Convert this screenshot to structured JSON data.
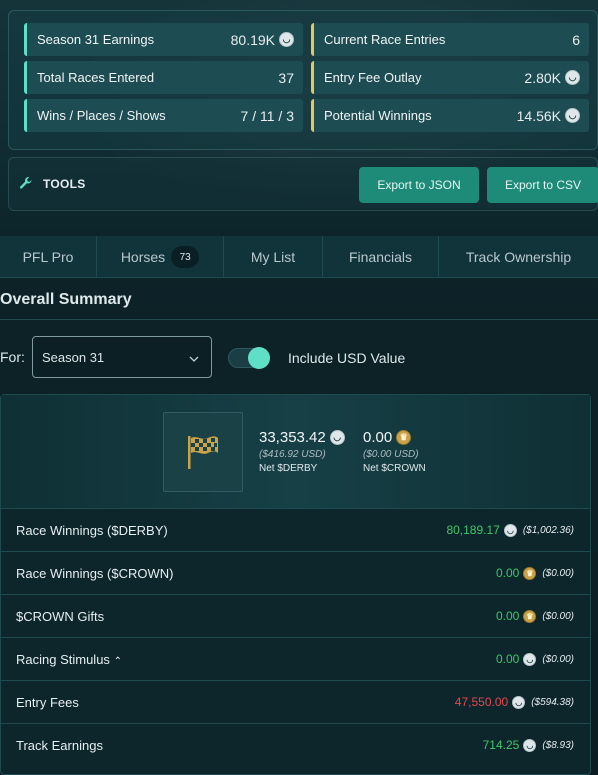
{
  "stats": {
    "left": [
      {
        "label": "Season 31 Earnings",
        "value": "80.19K",
        "coin": "derby"
      },
      {
        "label": "Total Races Entered",
        "value": "37",
        "coin": ""
      },
      {
        "label": "Wins / Places / Shows",
        "value": "7 / 11 / 3",
        "coin": ""
      }
    ],
    "right": [
      {
        "label": "Current Race Entries",
        "value": "6",
        "coin": ""
      },
      {
        "label": "Entry Fee Outlay",
        "value": "2.80K",
        "coin": "derby"
      },
      {
        "label": "Potential Winnings",
        "value": "14.56K",
        "coin": "derby"
      }
    ]
  },
  "tools": {
    "label": "TOOLS",
    "export_json": "Export to JSON",
    "export_csv": "Export to CSV"
  },
  "tabs": [
    {
      "label": "PFL Pro"
    },
    {
      "label": "Horses",
      "count": "73"
    },
    {
      "label": "My List"
    },
    {
      "label": "Financials"
    },
    {
      "label": "Track Ownership"
    }
  ],
  "summary": {
    "title": "Overall Summary",
    "for_label": "For:",
    "season_select": "Season 31",
    "toggle_label": "Include USD Value",
    "toggle_on": true
  },
  "net": {
    "derby_value": "33,353.42",
    "derby_usd": "($416.92 USD)",
    "derby_caption": "Net $DERBY",
    "crown_value": "0.00",
    "crown_usd": "($0.00 USD)",
    "crown_caption": "Net $CROWN"
  },
  "rows": [
    {
      "label": "Race Winnings ($DERBY)",
      "amount": "80,189.17",
      "coin": "derby",
      "usd": "($1,002.36)",
      "tone": "green"
    },
    {
      "label": "Race Winnings ($CROWN)",
      "amount": "0.00",
      "coin": "crown",
      "usd": "($0.00)",
      "tone": "green"
    },
    {
      "label": "$CROWN Gifts",
      "amount": "0.00",
      "coin": "crown",
      "usd": "($0.00)",
      "tone": "green"
    },
    {
      "label": "Racing Stimulus",
      "amount": "0.00",
      "coin": "derby",
      "usd": "($0.00)",
      "tone": "green"
    },
    {
      "label": "Entry Fees",
      "amount": "47,550.00",
      "coin": "derby",
      "usd": "($594.38)",
      "tone": "red"
    },
    {
      "label": "Track Earnings",
      "amount": "714.25",
      "coin": "derby",
      "usd": "($8.93)",
      "tone": "green"
    }
  ],
  "colors": {
    "accent_teal": "#5fe0c6",
    "accent_gold": "#e8c65a",
    "positive": "#3ec76a",
    "negative": "#e0484e",
    "button": "#1e8a78"
  }
}
